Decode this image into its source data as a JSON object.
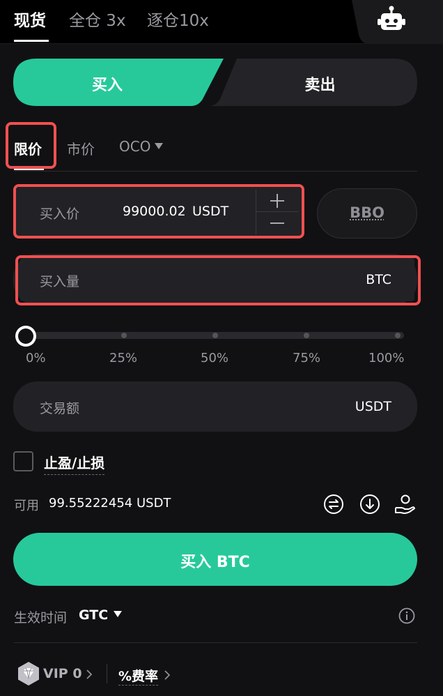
{
  "top_tabs": [
    {
      "label": "现货",
      "active": true
    },
    {
      "label": "全仓 3x",
      "active": false
    },
    {
      "label": "逐仓10x",
      "active": false
    }
  ],
  "robot_icon": "robot-icon",
  "side": {
    "buy_label": "买入",
    "sell_label": "卖出",
    "selected": "buy"
  },
  "order_types": [
    {
      "label": "限价",
      "active": true
    },
    {
      "label": "市价",
      "active": false
    },
    {
      "label": "OCO",
      "active": false,
      "has_dropdown": true
    }
  ],
  "price_field": {
    "label": "买入价",
    "value": "99000.02",
    "unit": "USDT"
  },
  "bbo_label": "BBO",
  "amount_field": {
    "label": "买入量",
    "unit": "BTC"
  },
  "slider": {
    "value_percent": 0,
    "marks": [
      "0%",
      "25%",
      "50%",
      "75%",
      "100%"
    ]
  },
  "total_field": {
    "label": "交易额",
    "unit": "USDT"
  },
  "tpsl": {
    "label": "止盈/止损",
    "checked": false
  },
  "available": {
    "label": "可用",
    "value": "99.55222454 USDT"
  },
  "available_icons": [
    "transfer-icon",
    "deposit-icon",
    "borrow-icon"
  ],
  "submit_label": "买入 BTC",
  "time_in_force": {
    "label": "生效时间",
    "value": "GTC"
  },
  "vip": {
    "label": "VIP 0"
  },
  "fee_label": "%费率",
  "colors": {
    "accent": "#27c99b",
    "highlight": "#f05050",
    "background": "#111113",
    "field": "#222226"
  }
}
